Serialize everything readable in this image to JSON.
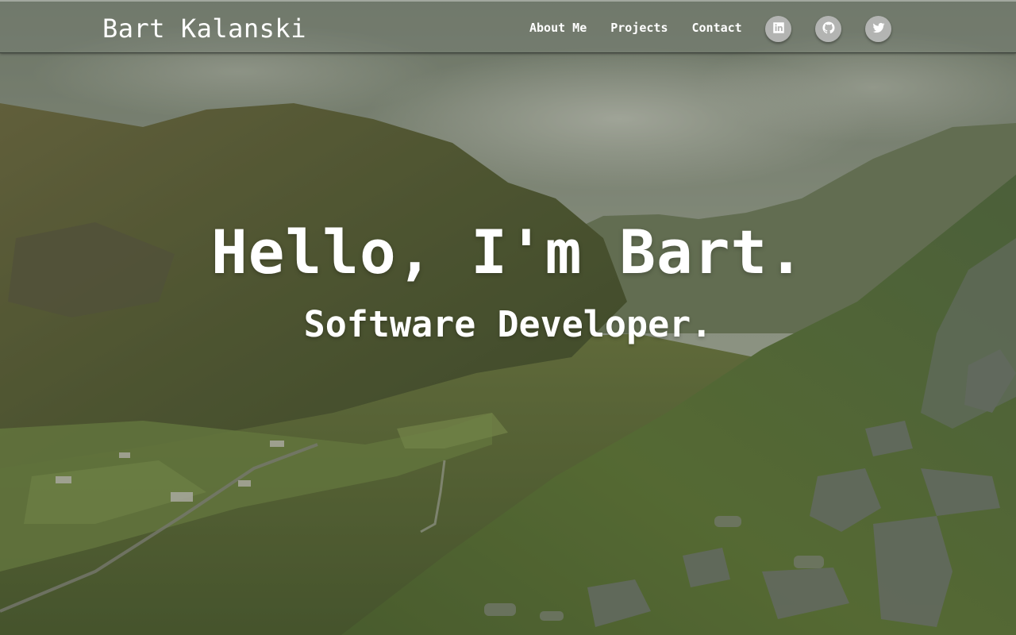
{
  "header": {
    "brand": "Bart Kalanski",
    "nav": [
      {
        "label": "About Me"
      },
      {
        "label": "Projects"
      },
      {
        "label": "Contact"
      }
    ],
    "social": [
      {
        "icon": "linkedin-icon"
      },
      {
        "icon": "github-icon"
      },
      {
        "icon": "twitter-icon"
      }
    ]
  },
  "hero": {
    "title": "Hello, I'm Bart.",
    "subtitle": "Software Developer."
  },
  "colors": {
    "text": "#ffffff",
    "navbar": "#7a8076",
    "social_button": "#bebebe"
  }
}
